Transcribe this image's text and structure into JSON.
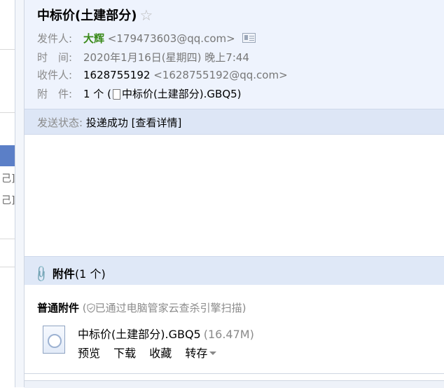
{
  "email": {
    "subject": "中标价(土建部分)",
    "sender_label": "发件人:",
    "sender_name": "大辉",
    "sender_address": "<179473603@qq.com>",
    "time_label": "时　间:",
    "time_value": "2020年1月16日(星期四) 晚上7:44",
    "recipient_label": "收件人:",
    "recipient_name": "1628755192",
    "recipient_address": "<1628755192@qq.com>",
    "attachment_label": "附　件:",
    "attachment_count": "1 个 (",
    "attachment_inline_name": "中标价(土建部分).GBQ5)"
  },
  "status": {
    "label": "发送状态:",
    "value": "投递成功",
    "details_link": "[查看详情]"
  },
  "attachments": {
    "header_title": "附件",
    "header_count": "(1 个)",
    "kind_label": "普通附件",
    "scan_prefix": "(",
    "scan_text": "已通过电脑管家云查杀引擎扫描)",
    "file": {
      "name": "中标价(土建部分).GBQ5",
      "size": "(16.47M)",
      "actions": {
        "preview": "预览",
        "download": "下载",
        "favorite": "收藏",
        "save_to": "转存"
      }
    }
  },
  "sidebar": {
    "brackets": [
      "己]",
      "己]"
    ]
  },
  "colors": {
    "header_bg": "#eef3fd",
    "status_bg": "#dde6f6",
    "sender_name": "#3a8a1a",
    "sidebar_selected": "#5b7fc7"
  },
  "icons": {
    "star": "star-icon",
    "contact_card": "contact-card-icon",
    "file_small": "file-icon",
    "paperclip": "paperclip-icon",
    "shield": "shield-icon",
    "file_thumb": "file-thumbnail-icon",
    "dropdown": "chevron-down-icon"
  }
}
